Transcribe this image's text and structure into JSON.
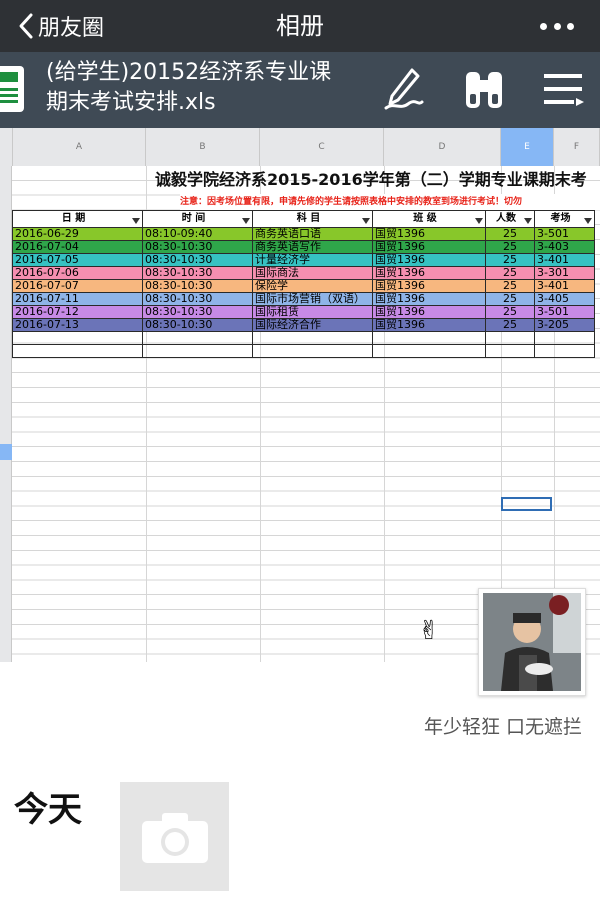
{
  "navbar": {
    "back_label": "朋友圈",
    "title": "相册",
    "back_icon": "chevron-left-icon",
    "more_icon": "more-dots-icon"
  },
  "document": {
    "title": "(给学生)20152经济系专业课期末考试安排.xls",
    "tools": [
      "draw-pen-icon",
      "binoculars-search-icon",
      "menu-icon"
    ]
  },
  "sheet": {
    "column_letters": [
      "A",
      "B",
      "C",
      "D",
      "E",
      "F"
    ],
    "selected_column": "E",
    "title": "诚毅学院经济系2015-2016学年第（二）学期专业课期末考",
    "note": "注意：因考场位置有限，申请先修的学生请按照表格中安排的教室到场进行考试！切勿",
    "headers": [
      "日 期",
      "时 间",
      "科 目",
      "班 级",
      "人数",
      "考场"
    ],
    "rows": [
      {
        "date": "2016-06-29",
        "time": "08:10-09:40",
        "subject": "商务英语口语",
        "class": "国贸1396",
        "count": "25",
        "room": "3-501",
        "color": "#88c72a"
      },
      {
        "date": "2016-07-04",
        "time": "08:30-10:30",
        "subject": "商务英语写作",
        "class": "国贸1396",
        "count": "25",
        "room": "3-403",
        "color": "#2fa64a"
      },
      {
        "date": "2016-07-05",
        "time": "08:30-10:30",
        "subject": "计量经济学",
        "class": "国贸1396",
        "count": "25",
        "room": "3-401",
        "color": "#36c2c2"
      },
      {
        "date": "2016-07-06",
        "time": "08:30-10:30",
        "subject": "国际商法",
        "class": "国贸1396",
        "count": "25",
        "room": "3-301",
        "color": "#f58fb0"
      },
      {
        "date": "2016-07-07",
        "time": "08:30-10:30",
        "subject": "保险学",
        "class": "国贸1396",
        "count": "25",
        "room": "3-401",
        "color": "#f7b77f"
      },
      {
        "date": "2016-07-11",
        "time": "08:30-10:30",
        "subject": "国际市场营销（双语）",
        "class": "国贸1396",
        "count": "25",
        "room": "3-405",
        "color": "#8fb4e8"
      },
      {
        "date": "2016-07-12",
        "time": "08:30-10:30",
        "subject": "国际租赁",
        "class": "国贸1396",
        "count": "25",
        "room": "3-501",
        "color": "#c78ae6"
      },
      {
        "date": "2016-07-13",
        "time": "08:30-10:30",
        "subject": "国际经济合作",
        "class": "国贸1396",
        "count": "25",
        "room": "3-205",
        "color": "#6b74b8"
      }
    ]
  },
  "post": {
    "emoji": "✌",
    "caption": "年少轻狂 口无遮拦"
  },
  "today_section": {
    "label": "今天",
    "camera_icon": "camera-icon"
  }
}
